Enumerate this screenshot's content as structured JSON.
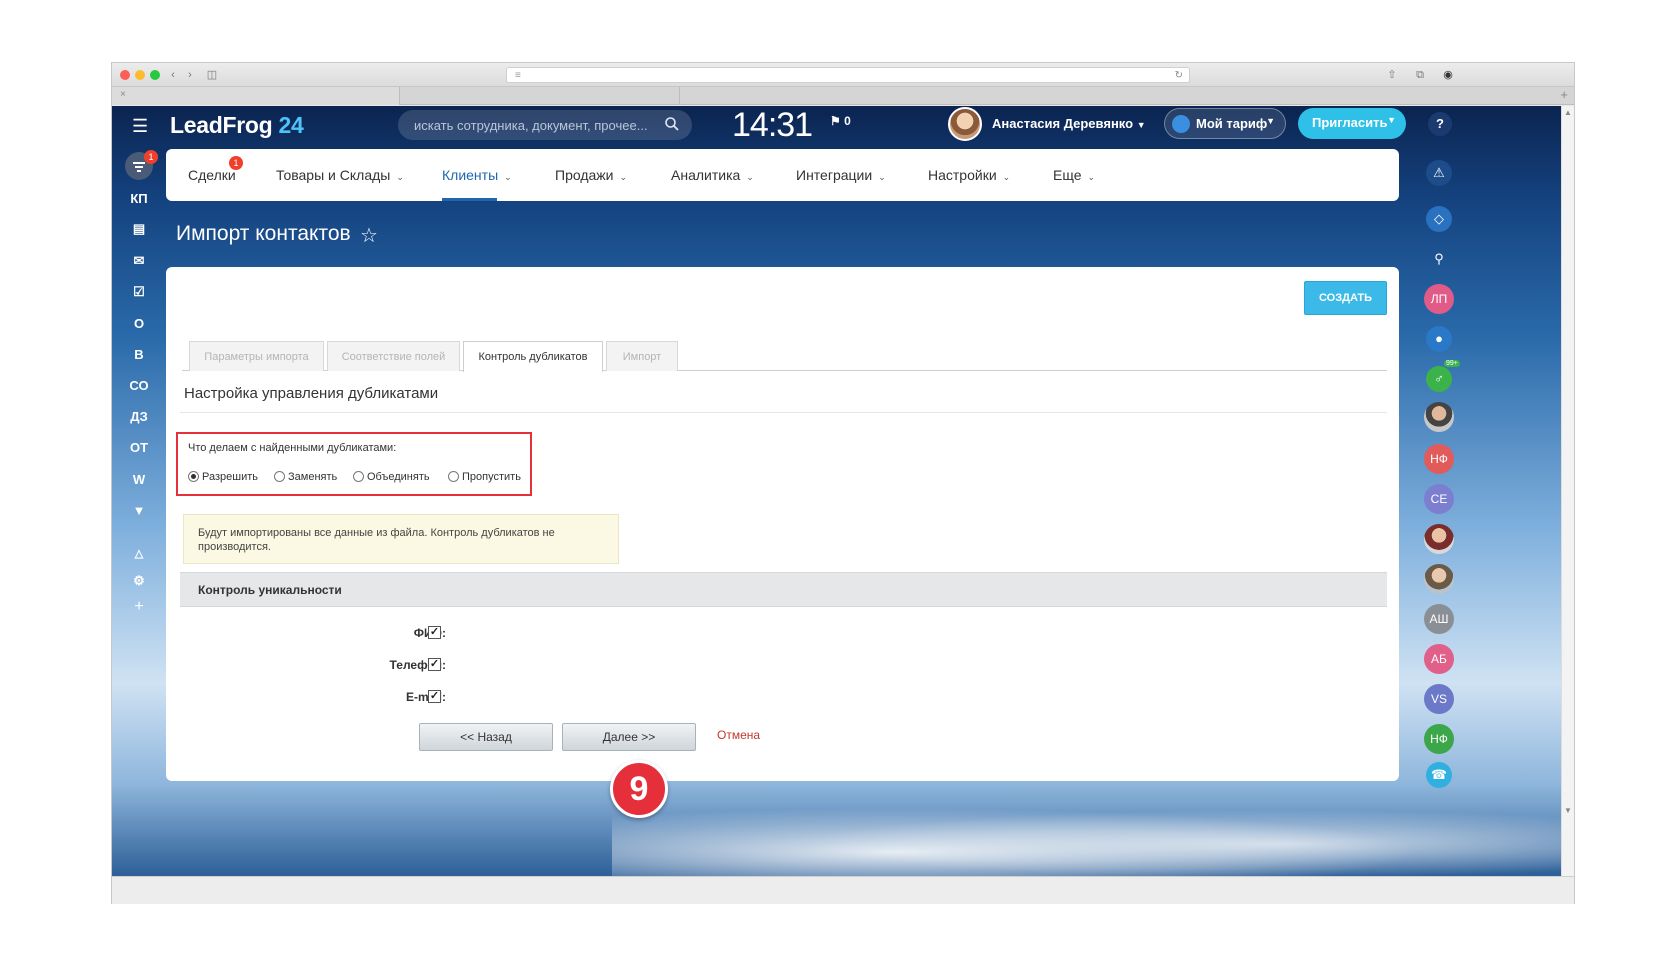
{
  "header": {
    "logo_main": "LeadFrog",
    "logo_num": "24",
    "search_placeholder": "искать сотрудника, документ, прочее...",
    "clock": "14:31",
    "flag_count": "0",
    "user_name": "Анастасия Деревянко",
    "tariff_label": "Мой тариф",
    "invite_label": "Пригласить"
  },
  "left_sidebar": {
    "badge": "1",
    "items": [
      "КП",
      "О",
      "В",
      "СО",
      "ДЗ",
      "ОТ",
      "W"
    ]
  },
  "nav": {
    "badge": "1",
    "items": [
      {
        "label": "Сделки"
      },
      {
        "label": "Товары и Склады"
      },
      {
        "label": "Клиенты"
      },
      {
        "label": "Продажи"
      },
      {
        "label": "Аналитика"
      },
      {
        "label": "Интеграции"
      },
      {
        "label": "Настройки"
      },
      {
        "label": "Еще"
      }
    ]
  },
  "page": {
    "title": "Импорт контактов",
    "create_label": "СОЗДАТЬ",
    "tabs": [
      "Параметры импорта",
      "Соответствие полей",
      "Контроль дубликатов",
      "Импорт"
    ],
    "active_tab": 2,
    "section_title": "Настройка управления дубликатами",
    "dup_question": "Что делаем с найденными дубликатами:",
    "dup_options": [
      "Разрешить",
      "Заменять",
      "Объединять",
      "Пропустить"
    ],
    "dup_selected": 0,
    "note": "Будут импортированы все данные из файла. Контроль дубликатов не производится.",
    "uniq_title": "Контроль уникальности",
    "fields": [
      {
        "label": "ФИО:",
        "checked": true
      },
      {
        "label": "Телефон:",
        "checked": true
      },
      {
        "label": "E-mail:",
        "checked": true
      }
    ],
    "back_label": "<< Назад",
    "next_label": "Далее >>",
    "cancel_label": "Отмена"
  },
  "step_marker": "9",
  "right_sidebar": {
    "badge": "99+",
    "avatars": [
      "ЛП",
      "НФ",
      "СЕ",
      "АШ",
      "АБ",
      "VS",
      "НФ"
    ]
  },
  "colors": {
    "accent": "#2067b0",
    "create_button": "#3bb9e8",
    "highlight": "#e5303b",
    "invite_button": "#2fc0e7"
  }
}
